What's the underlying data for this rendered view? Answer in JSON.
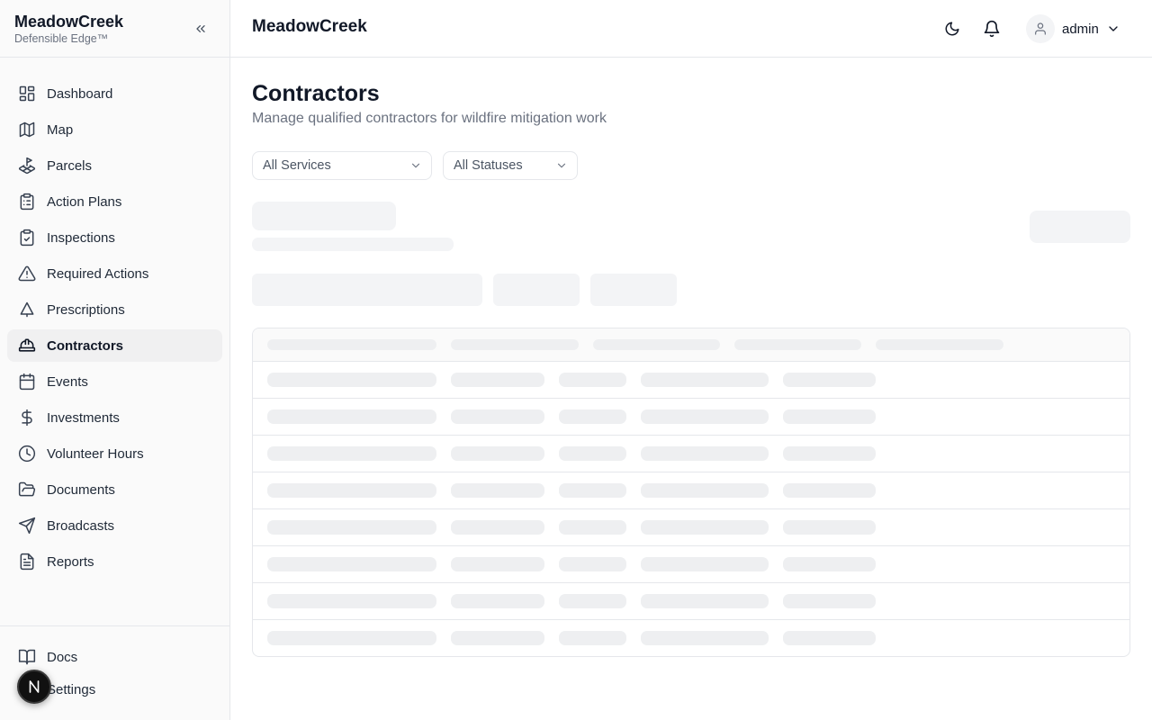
{
  "brand": {
    "name": "MeadowCreek",
    "tagline": "Defensible Edge™"
  },
  "sidebar": {
    "collapse_icon": "chevrons-left-icon",
    "items": [
      {
        "label": "Dashboard",
        "icon": "layout-grid-icon",
        "active": false
      },
      {
        "label": "Map",
        "icon": "map-icon",
        "active": false
      },
      {
        "label": "Parcels",
        "icon": "land-plot-icon",
        "active": false
      },
      {
        "label": "Action Plans",
        "icon": "clipboard-list-icon",
        "active": false
      },
      {
        "label": "Inspections",
        "icon": "clipboard-check-icon",
        "active": false
      },
      {
        "label": "Required Actions",
        "icon": "alert-triangle-icon",
        "active": false
      },
      {
        "label": "Prescriptions",
        "icon": "tree-icon",
        "active": false
      },
      {
        "label": "Contractors",
        "icon": "hard-hat-icon",
        "active": true
      },
      {
        "label": "Events",
        "icon": "calendar-icon",
        "active": false
      },
      {
        "label": "Investments",
        "icon": "dollar-sign-icon",
        "active": false
      },
      {
        "label": "Volunteer Hours",
        "icon": "clock-icon",
        "active": false
      },
      {
        "label": "Documents",
        "icon": "folder-open-icon",
        "active": false
      },
      {
        "label": "Broadcasts",
        "icon": "send-icon",
        "active": false
      },
      {
        "label": "Reports",
        "icon": "file-text-icon",
        "active": false
      }
    ],
    "bottom_items": [
      {
        "label": "Docs",
        "icon": "book-open-icon"
      },
      {
        "label": "Settings",
        "icon": "settings-icon"
      }
    ],
    "badge_letter": "N"
  },
  "header": {
    "title": "MeadowCreek",
    "theme_icon": "moon-icon",
    "notification_icon": "bell-icon",
    "user": {
      "name": "admin",
      "icon": "user-icon"
    }
  },
  "page": {
    "title": "Contractors",
    "subtitle": "Manage qualified contractors for wildfire mitigation work"
  },
  "filters": {
    "service": {
      "selected": "All Services"
    },
    "status": {
      "selected": "All Statuses"
    }
  },
  "colors": {
    "skeleton": "#f3f4f6",
    "border": "#e5e7eb",
    "active_nav": "#f0f0f1"
  },
  "loading": true
}
